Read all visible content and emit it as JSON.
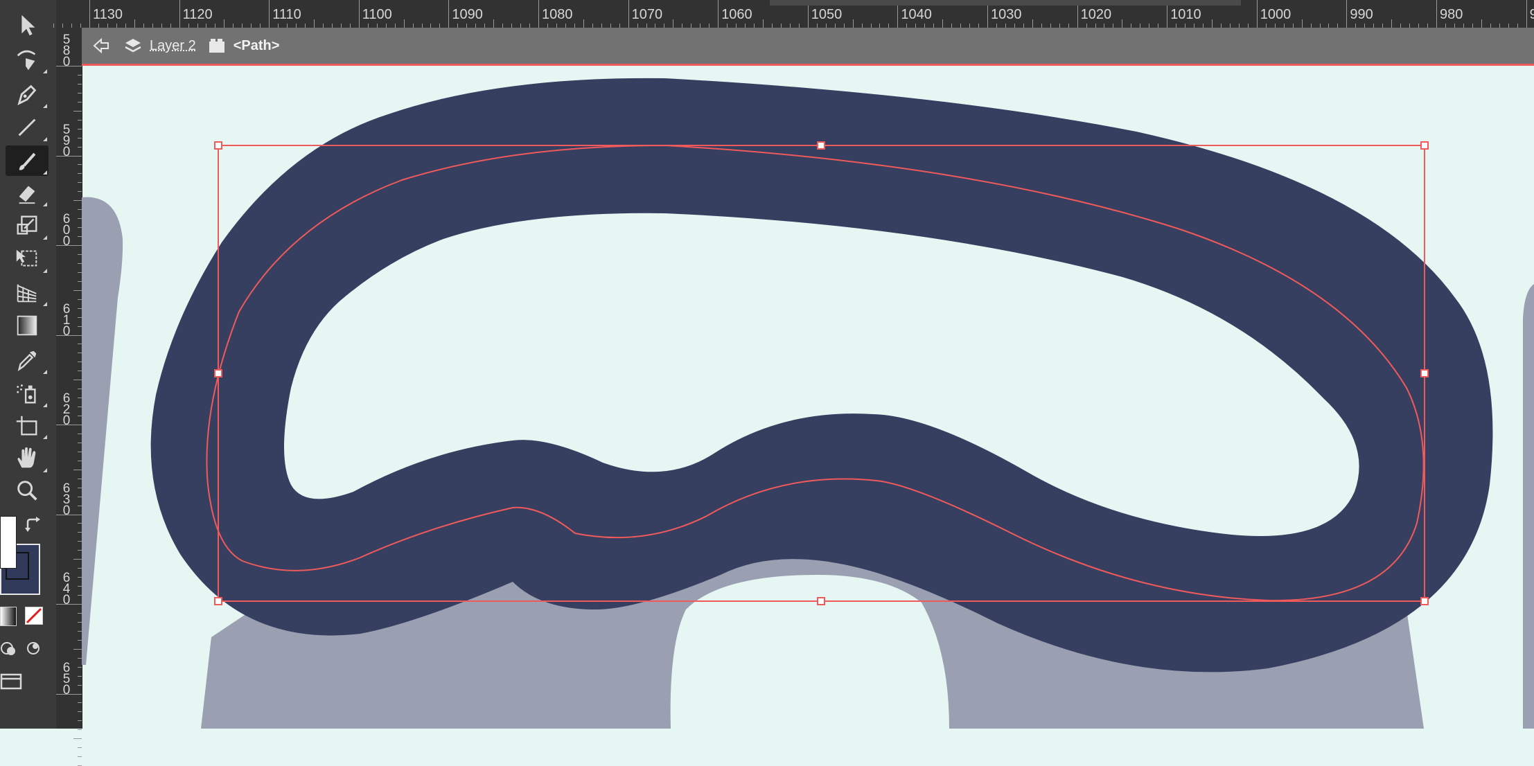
{
  "ruler": {
    "horizontal_labels": [
      "1130",
      "1120",
      "1110",
      "1100",
      "1090",
      "1080",
      "1070",
      "1060",
      "1050",
      "1040",
      "1030",
      "1020",
      "1010",
      "1000",
      "990",
      "980",
      "9"
    ],
    "vertical_labels": [
      "5\n8\n0",
      "5\n9\n0",
      "6\n0\n0",
      "6\n1\n0",
      "6\n2\n0",
      "6\n3\n0",
      "6\n4\n0",
      "6\n5\n0"
    ]
  },
  "isolation_bar": {
    "layer_label": "Layer 2",
    "path_label": "<Path>"
  },
  "toolbar": {
    "tools": [
      {
        "name": "selection-tool",
        "icon": "arrow-icon"
      },
      {
        "name": "curvature-tool",
        "icon": "curvature-pen-icon"
      },
      {
        "name": "pen-tool",
        "icon": "pen-icon"
      },
      {
        "name": "line-tool",
        "icon": "line-icon"
      },
      {
        "name": "paintbrush-tool",
        "icon": "paintbrush-icon",
        "active": true
      },
      {
        "name": "eraser-tool",
        "icon": "eraser-icon"
      },
      {
        "name": "scale-tool",
        "icon": "scale-icon"
      },
      {
        "name": "free-transform-tool",
        "icon": "free-transform-icon"
      },
      {
        "name": "perspective-grid-tool",
        "icon": "perspective-grid-icon"
      },
      {
        "name": "gradient-tool",
        "icon": "gradient-icon"
      },
      {
        "name": "eyedropper-tool",
        "icon": "eyedropper-icon"
      },
      {
        "name": "symbol-sprayer-tool",
        "icon": "symbol-sprayer-icon"
      },
      {
        "name": "artboard-tool",
        "icon": "artboard-icon"
      },
      {
        "name": "hand-tool",
        "icon": "hand-icon"
      },
      {
        "name": "zoom-tool",
        "icon": "zoom-icon"
      }
    ]
  },
  "colors": {
    "canvas_background": "#e6f6f3",
    "shape_fill": "#363f60",
    "back_shape_fill": "#9a9fb1",
    "selection": "#f05a5a",
    "inner_fill": "#ffffff"
  }
}
